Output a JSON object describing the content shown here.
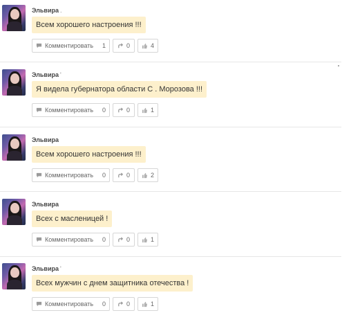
{
  "posts": [
    {
      "author": "Эльвира",
      "author_suffix": ".",
      "text": "Всем хорошего настроения !!!",
      "comment_label": "Комментировать",
      "comments": "1",
      "reshares": "0",
      "likes": "4"
    },
    {
      "author": "Эльвира",
      "author_suffix": "'",
      "text": "Я видела губернатора области С . Морозова !!!",
      "comment_label": "Комментировать",
      "comments": "0",
      "reshares": "0",
      "likes": "1"
    },
    {
      "author": "Эльвира",
      "author_suffix": "",
      "text": "Всем хорошего настроения !!!",
      "comment_label": "Комментировать",
      "comments": "0",
      "reshares": "0",
      "likes": "2"
    },
    {
      "author": "Эльвира",
      "author_suffix": "",
      "text": "Всех с масленицей !",
      "comment_label": "Комментировать",
      "comments": "0",
      "reshares": "0",
      "likes": "1"
    },
    {
      "author": "Эльвира",
      "author_suffix": "'",
      "text": "Всех мужчин с днем защитника отечества !",
      "comment_label": "Комментировать",
      "comments": "0",
      "reshares": "0",
      "likes": "1"
    }
  ],
  "icons": {
    "comment": "speech-bubble-icon",
    "reshare": "reshare-arrow-icon",
    "like": "thumbs-up-icon"
  },
  "colors": {
    "bubble_bg": "#fdf0cc",
    "divider": "#e6e6e6",
    "button_border": "#d6d6d6"
  }
}
